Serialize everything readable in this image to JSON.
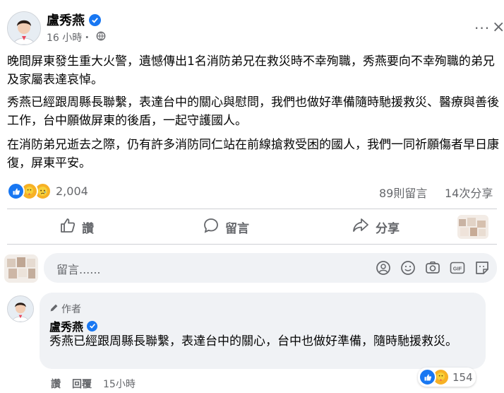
{
  "post": {
    "author": "盧秀燕",
    "time": "16 小時・",
    "paragraphs": [
      "晚間屏東發生重大火警，遺憾傳出1名消防弟兄在救災時不幸殉職，秀燕要向不幸殉職的弟兄及家屬表達哀悼。",
      "秀燕已經跟周縣長聯繫，表達台中的關心與慰問，我們也做好準備隨時馳援救災、醫療與善後工作，台中願做屏東的後盾，一起守護國人。",
      "在消防弟兄逝去之際，仍有許多消防同仁站在前線搶救受困的國人，我們一同祈願傷者早日康復，屏東平安。"
    ],
    "reaction_count": "2,004",
    "comments_count": "89則留言",
    "shares_count": "14次分享"
  },
  "actions": {
    "like": "讚",
    "comment": "留言",
    "share": "分享"
  },
  "comment_input": {
    "placeholder": "留言......"
  },
  "comment": {
    "badge": "作者",
    "author": "盧秀燕",
    "text": "秀燕已經跟周縣長聯繫，表達台中的關心，台中也做好準備，隨時馳援救災。",
    "reaction_count": "154",
    "like_label": "讚",
    "reply_label": "回覆",
    "time": "15小時"
  },
  "colors": {
    "brand_blue": "#1877f2",
    "secondary_text": "#65676b",
    "comment_bg": "#f0f2f5"
  },
  "icons": [
    "like-reaction-icon",
    "care-reaction-icon",
    "sad-reaction-icon",
    "globe-icon",
    "verified-icon",
    "pencil-icon",
    "sticker-icon",
    "emoji-icon",
    "camera-icon",
    "gif-icon",
    "stickers-icon"
  ]
}
